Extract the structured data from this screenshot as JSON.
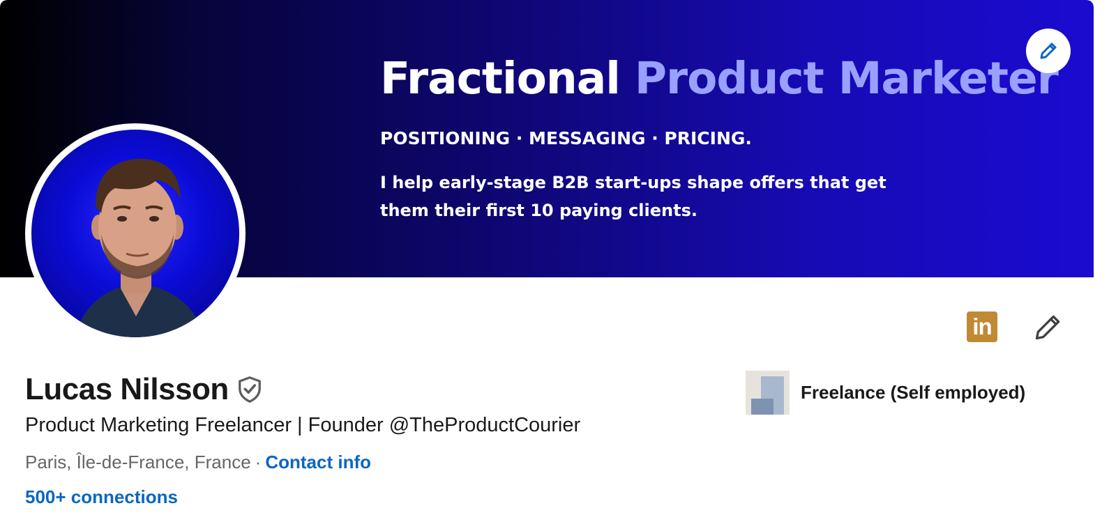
{
  "banner": {
    "headline_main": "Fractional",
    "headline_accent": "Product Marketer",
    "tagline": "POSITIONING · MESSAGING · PRICING.",
    "body": "I help early-stage B2B start-ups shape offers that get them their first 10 paying clients.",
    "colors": {
      "start": "#000000",
      "end": "#1a0bd0",
      "accent_text": "#9aa0ff"
    },
    "edit_icon": "pencil-icon"
  },
  "profile": {
    "name": "Lucas Nilsson",
    "verified_icon": "verified-shield-icon",
    "headline": "Product Marketing Freelancer | Founder @TheProductCourier",
    "location": "Paris, Île-de-France, France",
    "separator": "·",
    "contact_info_label": "Contact info",
    "connections_label": "500+ connections"
  },
  "actions": {
    "linkedin_badge_text": "in",
    "linkedin_badge_color": "#c08a34",
    "edit_icon": "pencil-icon"
  },
  "experience": {
    "company_name": "Freelance (Self employed)"
  },
  "colors": {
    "link": "#0a66c2",
    "text": "#191919",
    "muted": "#666666"
  }
}
